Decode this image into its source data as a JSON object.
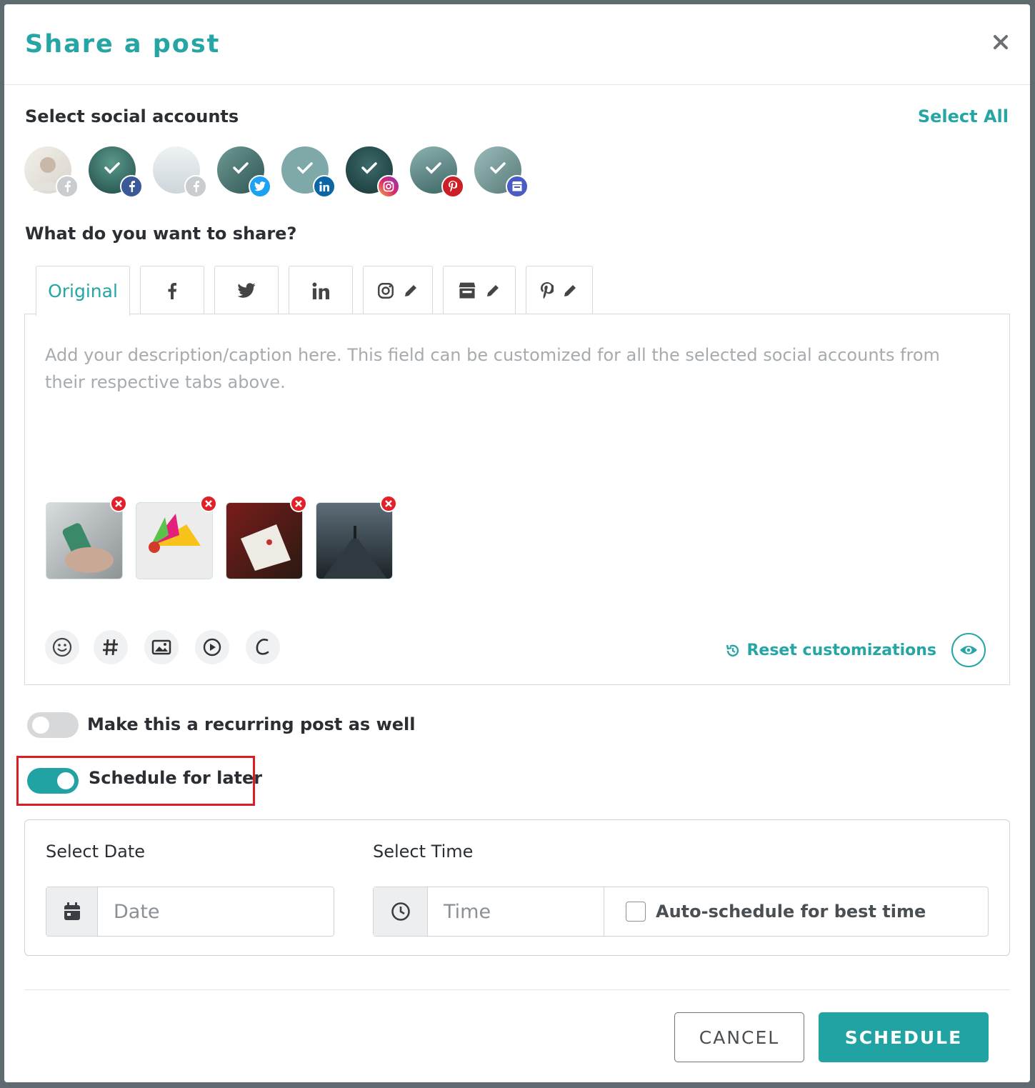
{
  "modal": {
    "title": "Share a post"
  },
  "accounts": {
    "label": "Select social accounts",
    "select_all": "Select All",
    "items": [
      {
        "platform": "facebook",
        "selected": false,
        "color": "#c9cdd0"
      },
      {
        "platform": "facebook",
        "selected": true,
        "color": "#3b5998"
      },
      {
        "platform": "facebook",
        "selected": false,
        "color": "#c9cdd0"
      },
      {
        "platform": "twitter",
        "selected": true,
        "color": "#1da1f2"
      },
      {
        "platform": "linkedin",
        "selected": true,
        "color": "#0077b5"
      },
      {
        "platform": "instagram",
        "selected": true,
        "color": "#d6286e"
      },
      {
        "platform": "pinterest",
        "selected": true,
        "color": "#cb2027"
      },
      {
        "platform": "google-business",
        "selected": true,
        "color": "#4a5bc4"
      }
    ]
  },
  "share": {
    "label": "What do you want to share?",
    "tabs": [
      {
        "label": "Original",
        "icon": "text"
      },
      {
        "label": "",
        "icon": "facebook-icon"
      },
      {
        "label": "",
        "icon": "twitter-icon"
      },
      {
        "label": "",
        "icon": "linkedin-icon"
      },
      {
        "label": "",
        "icon": "instagram-icon",
        "edit": true
      },
      {
        "label": "",
        "icon": "google-business-icon",
        "edit": true
      },
      {
        "label": "",
        "icon": "pinterest-icon",
        "edit": true
      }
    ],
    "placeholder": "Add your description/caption here. This field can be customized for all the selected social accounts from their respective tabs above.",
    "media_count": 4,
    "tools": [
      "emoji-icon",
      "hashtag-icon",
      "image-icon",
      "video-icon",
      "canva-icon"
    ],
    "reset_label": "Reset customizations"
  },
  "recurring": {
    "label": "Make this a recurring post as well",
    "on": false
  },
  "schedule_later": {
    "label": "Schedule for later",
    "on": true
  },
  "schedule": {
    "date_label": "Select Date",
    "date_placeholder": "Date",
    "time_label": "Select Time",
    "time_placeholder": "Time",
    "auto_label": "Auto-schedule for best time"
  },
  "footer": {
    "cancel": "CANCEL",
    "schedule": "SCHEDULE"
  },
  "colors": {
    "accent": "#26a5a5",
    "highlight": "#d81f26"
  }
}
